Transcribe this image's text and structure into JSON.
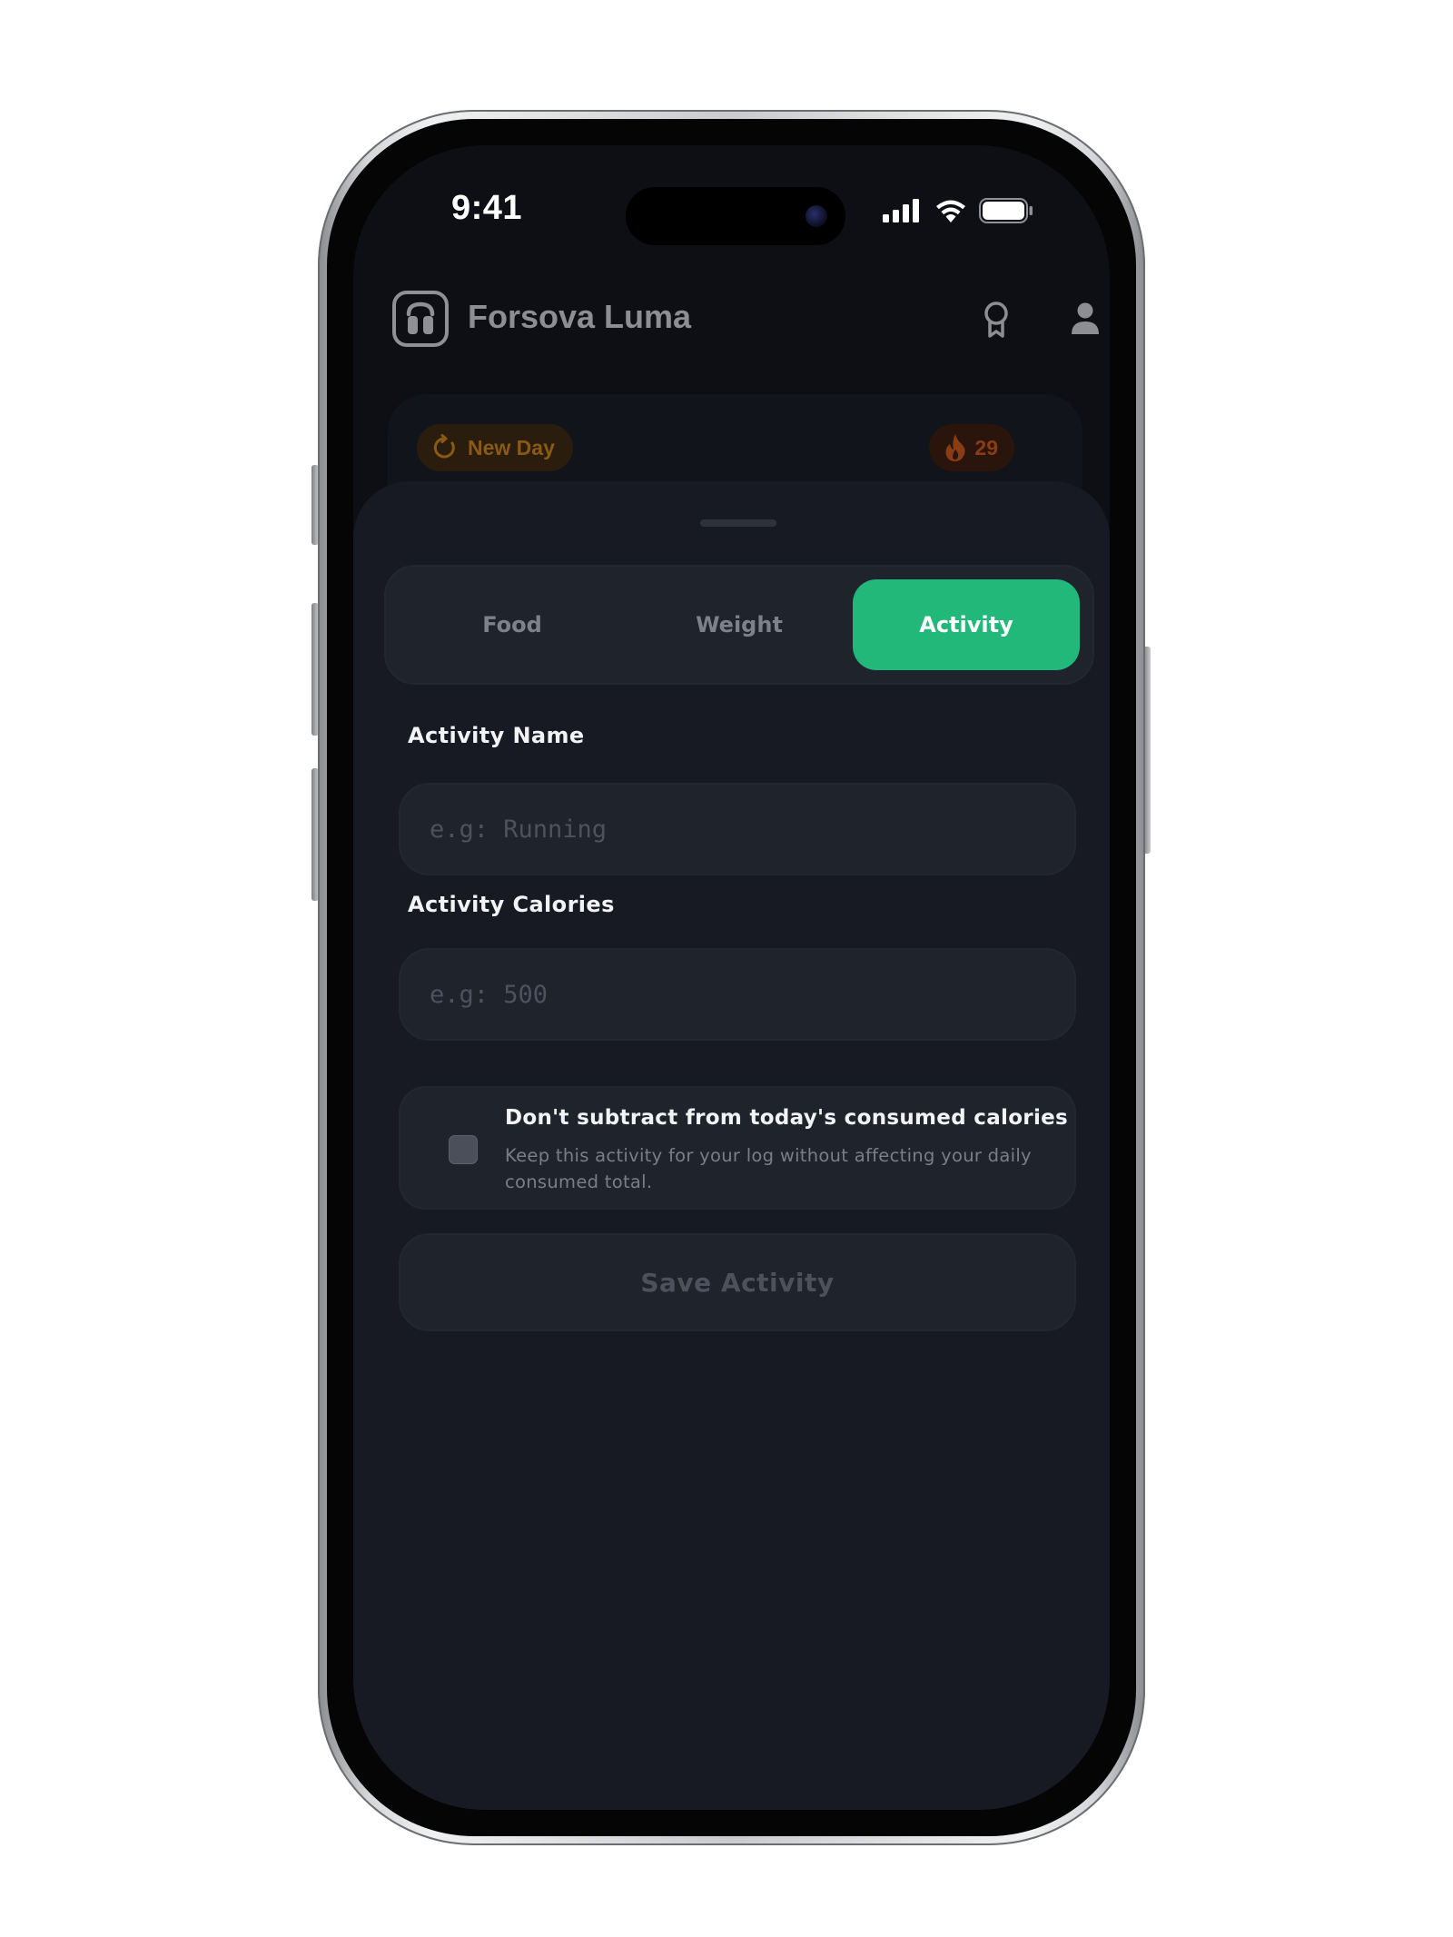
{
  "status_bar": {
    "time": "9:41"
  },
  "header": {
    "app_name": "Forsova Luma",
    "icons": [
      "app-logo-icon",
      "award-icon",
      "user-icon"
    ]
  },
  "summary": {
    "new_day_label": "New Day",
    "streak_count": "29",
    "icons": [
      "refresh-icon",
      "flame-icon"
    ]
  },
  "tabs": [
    {
      "label": "Food",
      "active": false
    },
    {
      "label": "Weight",
      "active": false
    },
    {
      "label": "Activity",
      "active": true
    }
  ],
  "form": {
    "activity_name": {
      "label": "Activity Name",
      "placeholder": "e.g: Running",
      "value": ""
    },
    "activity_calories": {
      "label": "Activity Calories",
      "placeholder": "e.g: 500",
      "value": ""
    },
    "exclude_option": {
      "title": "Don't subtract from today's consumed calories",
      "description": "Keep this activity for your log without affecting your daily consumed total.",
      "checked": false
    },
    "save_label": "Save Activity"
  },
  "colors": {
    "accent": "#22b87a",
    "sheet_background": "#171a22",
    "field_background": "#1f232c",
    "new_day": "#8a5a14",
    "streak": "#8a3c14"
  }
}
